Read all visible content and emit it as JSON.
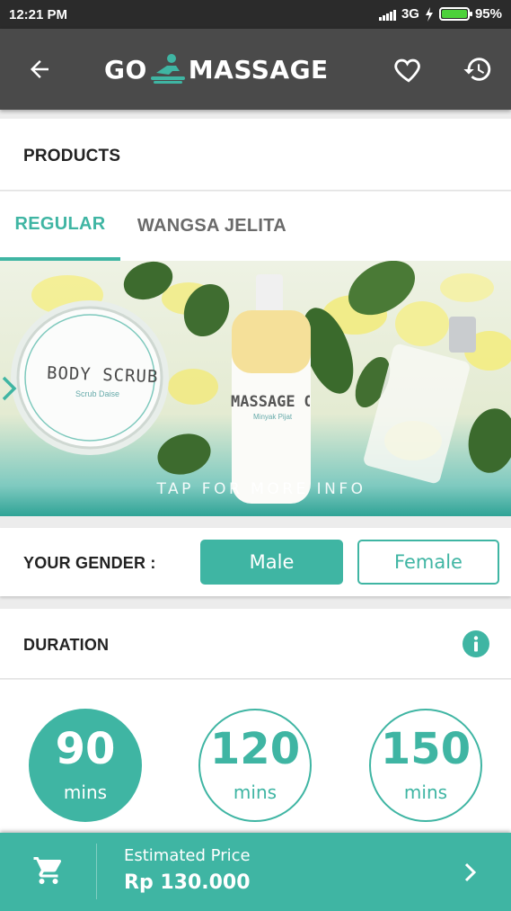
{
  "status_bar": {
    "time": "12:21 PM",
    "network": "3G",
    "battery": "95%",
    "battery_level": 0.95
  },
  "header": {
    "logo_left": "GO",
    "logo_right": "MASSAGE"
  },
  "products": {
    "title": "PRODUCTS"
  },
  "tabs": [
    {
      "label": "REGULAR",
      "active": true
    },
    {
      "label": "WANGSA JELITA",
      "active": false
    }
  ],
  "banner": {
    "jar_label": "BODY SCRUB",
    "jar_sub": "Scrub Daise",
    "bottle_label": "MASSAGE OIL",
    "bottle_sub": "Minyak Pijat",
    "hint": "TAP FOR MORE INFO"
  },
  "gender": {
    "title": "YOUR GENDER :",
    "male_label": "Male",
    "female_label": "Female",
    "selected": "Male"
  },
  "duration": {
    "title": "DURATION",
    "options": [
      {
        "value": "90",
        "unit": "mins",
        "selected": true
      },
      {
        "value": "120",
        "unit": "mins",
        "selected": false
      },
      {
        "value": "150",
        "unit": "mins",
        "selected": false
      }
    ]
  },
  "footer": {
    "label": "Estimated Price",
    "price": "Rp 130.000"
  },
  "colors": {
    "accent": "#3fb5a3",
    "app_bar": "#4a4a4a",
    "status_bar": "#2b2b2b"
  },
  "icons": [
    "back-arrow-icon",
    "massage-logo-icon",
    "heart-icon",
    "history-icon",
    "chevron-right-icon",
    "info-icon",
    "cart-icon"
  ]
}
